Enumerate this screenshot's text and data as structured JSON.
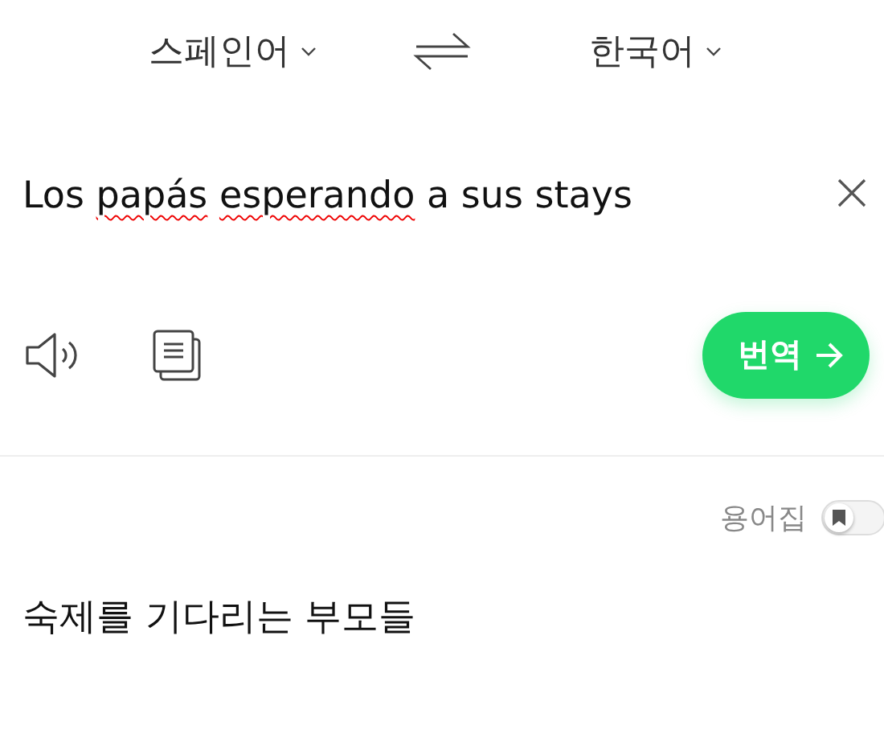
{
  "languages": {
    "source": "스페인어",
    "target": "한국어"
  },
  "source": {
    "words": [
      {
        "text": "Los",
        "misspelled": false
      },
      {
        "text": "papás",
        "misspelled": true
      },
      {
        "text": "esperando",
        "misspelled": true
      },
      {
        "text": "a",
        "misspelled": false
      },
      {
        "text": "sus",
        "misspelled": false
      },
      {
        "text": "stays",
        "misspelled": false
      }
    ]
  },
  "translate_button": "번역",
  "glossary": {
    "label": "용어집",
    "on": false
  },
  "result": "숙제를 기다리는 부모들"
}
